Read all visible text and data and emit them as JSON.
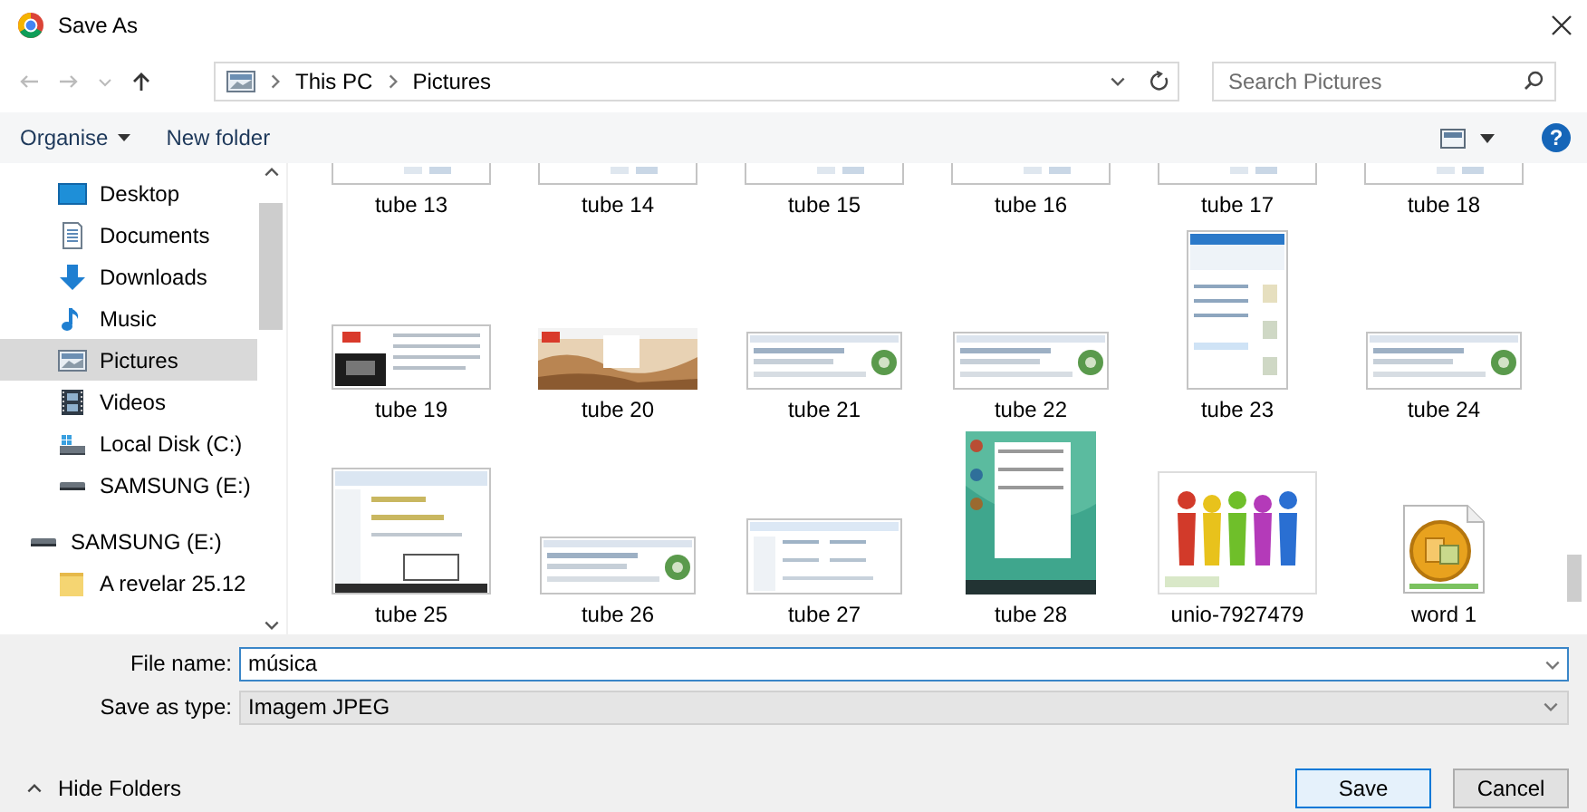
{
  "window": {
    "title": "Save As"
  },
  "navigation": {
    "breadcrumb": [
      "This PC",
      "Pictures"
    ],
    "search": {
      "placeholder": "Search Pictures"
    }
  },
  "toolbar": {
    "buttons": [
      {
        "label": "Organise",
        "kind": "menu"
      },
      {
        "label": "New folder",
        "kind": "plain"
      }
    ],
    "help": "?"
  },
  "sidebar": {
    "items": [
      {
        "label": "Desktop",
        "kind": "desktop",
        "selected": false
      },
      {
        "label": "Documents",
        "kind": "documents",
        "selected": false
      },
      {
        "label": "Downloads",
        "kind": "downloads",
        "selected": false
      },
      {
        "label": "Music",
        "kind": "music",
        "selected": false
      },
      {
        "label": "Pictures",
        "kind": "pictures",
        "selected": true
      },
      {
        "label": "Videos",
        "kind": "videos",
        "selected": false
      },
      {
        "label": "Local Disk (C:)",
        "kind": "disk",
        "selected": false
      },
      {
        "label": "SAMSUNG (E:)",
        "kind": "usb",
        "selected": false
      },
      {
        "label": "SAMSUNG (E:)",
        "kind": "usb",
        "selected": false,
        "children": [
          {
            "label": "A revelar 25.12",
            "kind": "folder",
            "selected": false
          }
        ]
      }
    ]
  },
  "files": [
    {
      "label": "tube 13",
      "kind": "picture"
    },
    {
      "label": "tube 14",
      "kind": "picture"
    },
    {
      "label": "tube 15",
      "kind": "picture"
    },
    {
      "label": "tube 16",
      "kind": "picture"
    },
    {
      "label": "tube 17",
      "kind": "picture"
    },
    {
      "label": "tube 18",
      "kind": "picture"
    },
    {
      "label": "tube 19",
      "kind": "picture"
    },
    {
      "label": "tube 20",
      "kind": "picture"
    },
    {
      "label": "tube 21",
      "kind": "picture"
    },
    {
      "label": "tube 22",
      "kind": "picture"
    },
    {
      "label": "tube 23",
      "kind": "picture"
    },
    {
      "label": "tube 24",
      "kind": "picture"
    },
    {
      "label": "tube 25",
      "kind": "picture"
    },
    {
      "label": "tube 26",
      "kind": "picture"
    },
    {
      "label": "tube 27",
      "kind": "picture"
    },
    {
      "label": "tube 28",
      "kind": "picture"
    },
    {
      "label": "unio-7927479",
      "kind": "picture"
    },
    {
      "label": "word 1",
      "kind": "document"
    }
  ],
  "form": {
    "file_name": {
      "label": "File name:",
      "value": "música"
    },
    "save_as_type": {
      "label": "Save as type:",
      "value": "Imagem JPEG"
    }
  },
  "hide_folders": "Hide Folders",
  "buttons": [
    {
      "label": "Save",
      "kind": "default"
    },
    {
      "label": "Cancel",
      "kind": "normal"
    }
  ]
}
